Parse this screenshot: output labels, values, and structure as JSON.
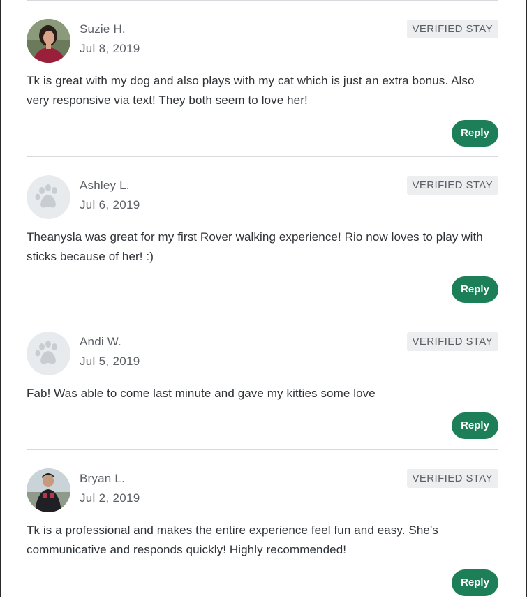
{
  "reviews": [
    {
      "name": "Suzie H.",
      "date": "Jul 8, 2019",
      "badge": "VERIFIED STAY",
      "text": "Tk is great with my dog and also plays with my cat which is just an extra bonus. Also very responsive via text! They both seem to love her!",
      "reply_label": "Reply",
      "avatar": "photo"
    },
    {
      "name": "Ashley L.",
      "date": "Jul 6, 2019",
      "badge": "VERIFIED STAY",
      "text": "Theanysla was great for my first Rover walking experience! Rio now loves to play with sticks because of her! :)",
      "reply_label": "Reply",
      "avatar": "paw-placeholder"
    },
    {
      "name": "Andi W.",
      "date": "Jul 5, 2019",
      "badge": "VERIFIED STAY",
      "text": "Fab! Was able to come last minute and gave my kitties some love",
      "reply_label": "Reply",
      "avatar": "paw-placeholder"
    },
    {
      "name": "Bryan L.",
      "date": "Jul 2, 2019",
      "badge": "VERIFIED STAY",
      "text": "Tk is a professional and makes the entire experience feel fun and easy. She's communicative and responds quickly! Highly recommended!",
      "reply_label": "Reply",
      "avatar": "photo"
    }
  ],
  "colors": {
    "reply_button": "#1d7f57",
    "badge_bg": "#eceef0",
    "divider": "#d7d9dc",
    "muted_text": "#5b6066"
  }
}
